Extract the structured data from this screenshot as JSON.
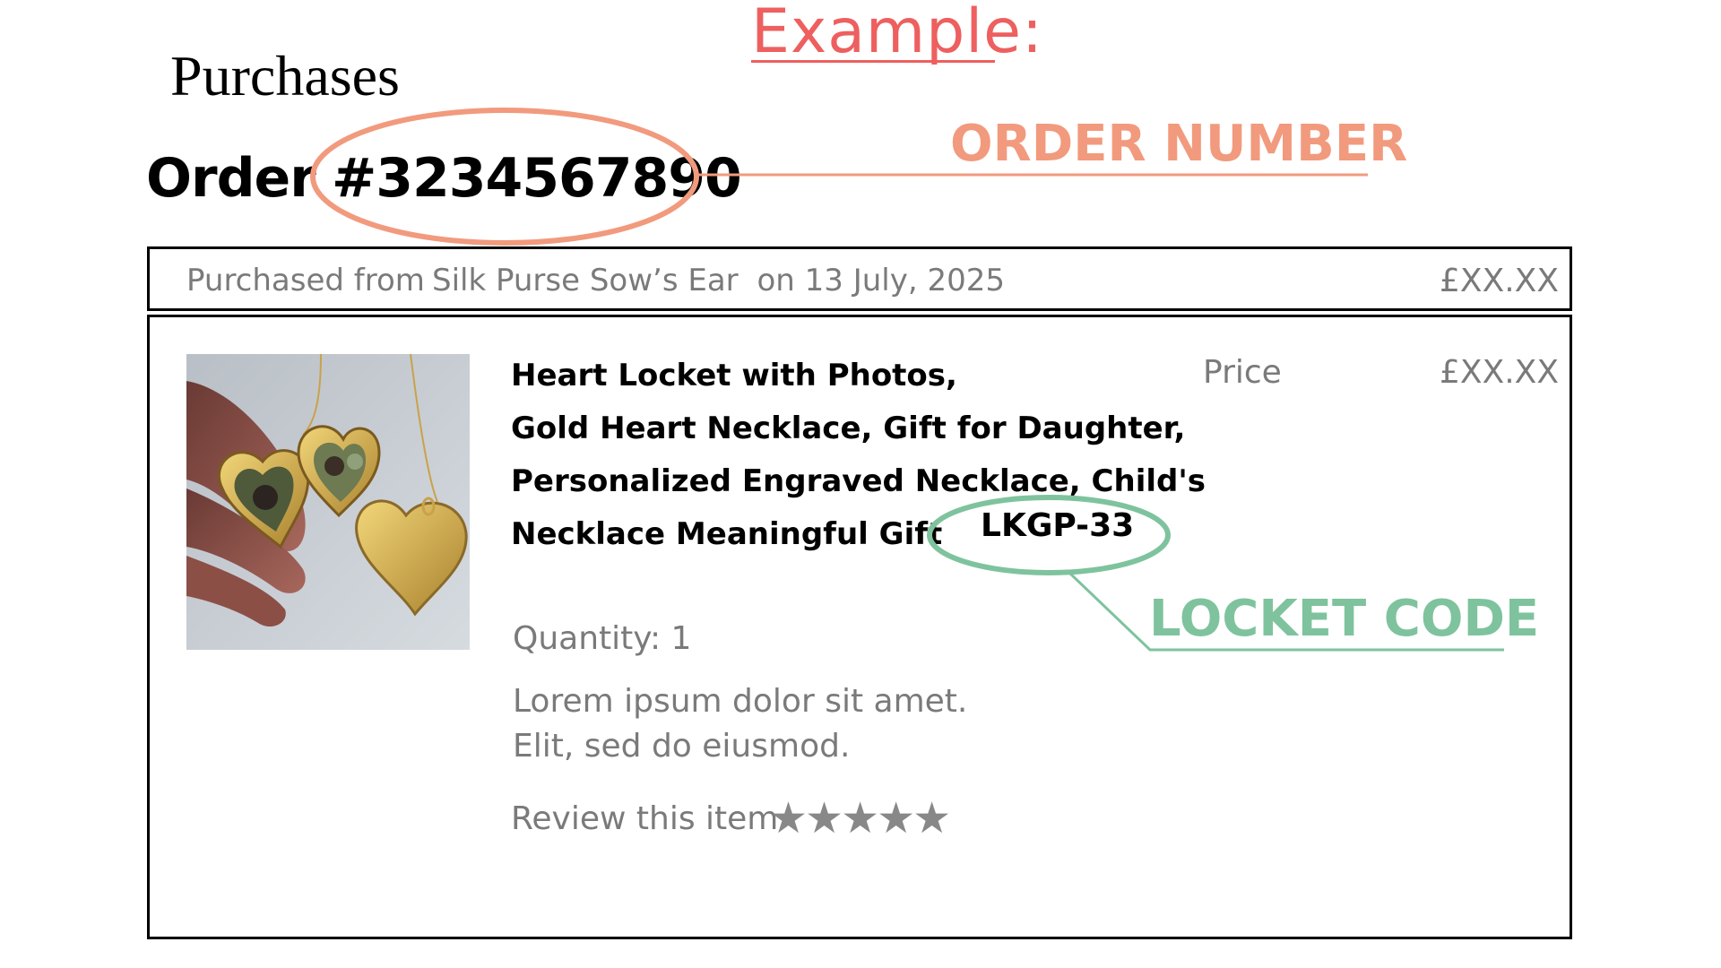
{
  "annotations": {
    "example_heading": "Example:",
    "order_number_callout": "ORDER NUMBER",
    "locket_code_callout": "LOCKET CODE",
    "order_callout_color": "#f29a7d",
    "locket_callout_color": "#7ec39e",
    "example_color": "#ee5f5f"
  },
  "page": {
    "title": "Purchases"
  },
  "order": {
    "label": "Order",
    "number": "#3234567890",
    "purchased_from_label": "Purchased from",
    "shop_name": "Silk Purse Sow’s Ear",
    "purchase_date": "on 13 July, 2025",
    "total": "£XX.XX"
  },
  "item": {
    "image_icon": "heart-locket-photo",
    "title_lines": [
      "Heart Locket with Photos,",
      "Gold Heart Necklace, Gift for Daughter,",
      "Personalized Engraved Necklace, Child's",
      "Necklace Meaningful Gift"
    ],
    "locket_code": "LKGP-33",
    "price_label": "Price",
    "price_value": "£XX.XX",
    "quantity": "Quantity: 1",
    "description_lines": [
      "Lorem ipsum dolor sit amet.",
      "Elit, sed do eiusmod."
    ],
    "review_label": "Review this item",
    "rating_stars": 5,
    "star_glyph": "★"
  }
}
